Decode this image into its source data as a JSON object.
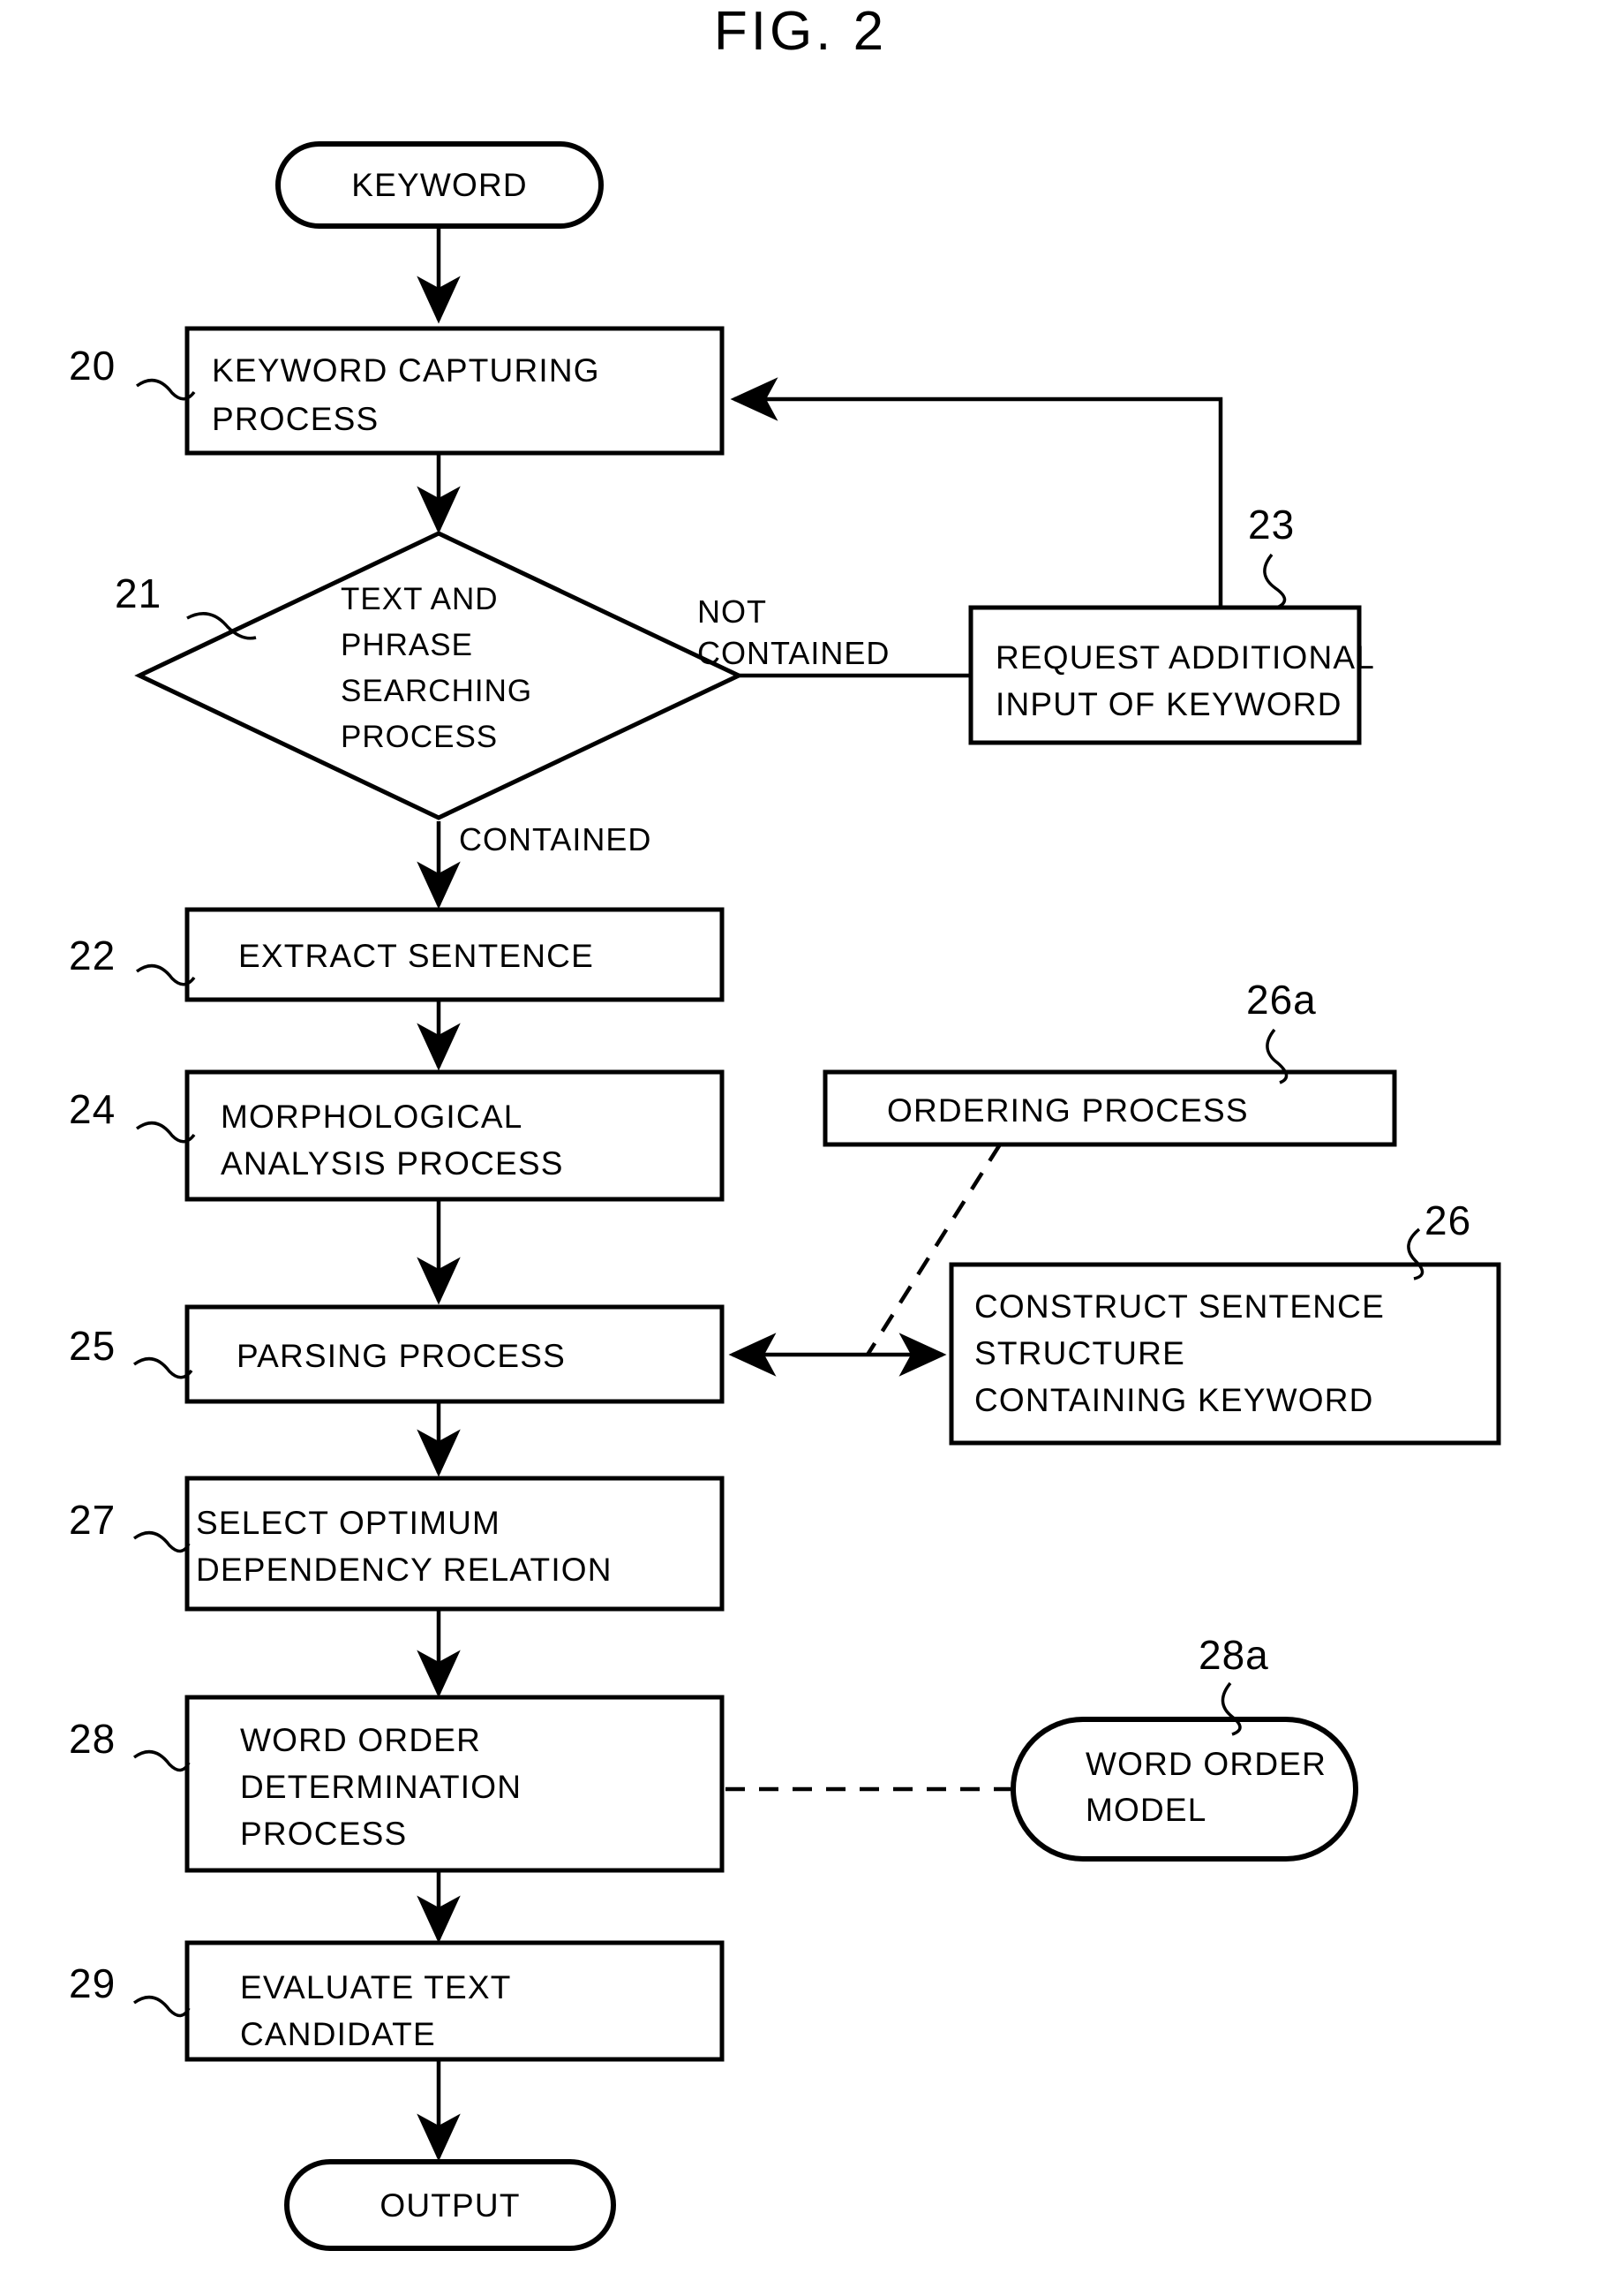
{
  "figure": {
    "title": "FIG. 2"
  },
  "nodes": {
    "start": {
      "label": "KEYWORD",
      "shape": "rounded-terminal"
    },
    "n20": {
      "ref": "20",
      "label_line1": "KEYWORD CAPTURING",
      "label_line2": "PROCESS",
      "shape": "process"
    },
    "n21": {
      "ref": "21",
      "label_line1": "TEXT AND",
      "label_line2": "PHRASE",
      "label_line3": "SEARCHING",
      "label_line4": "PROCESS",
      "shape": "decision"
    },
    "n23": {
      "ref": "23",
      "label_line1": "REQUEST ADDITIONAL",
      "label_line2": "INPUT OF KEYWORD",
      "shape": "process"
    },
    "n22": {
      "ref": "22",
      "label_line1": "EXTRACT SENTENCE",
      "shape": "process"
    },
    "n24": {
      "ref": "24",
      "label_line1": "MORPHOLOGICAL",
      "label_line2": "ANALYSIS PROCESS",
      "shape": "process"
    },
    "n26a": {
      "ref": "26a",
      "label_line1": "ORDERING PROCESS",
      "shape": "process"
    },
    "n25": {
      "ref": "25",
      "label_line1": "PARSING PROCESS",
      "shape": "process"
    },
    "n26": {
      "ref": "26",
      "label_line1": "CONSTRUCT SENTENCE",
      "label_line2": "STRUCTURE",
      "label_line3": "CONTAINING KEYWORD",
      "shape": "process"
    },
    "n27": {
      "ref": "27",
      "label_line1": "SELECT OPTIMUM",
      "label_line2": "DEPENDENCY RELATION",
      "shape": "process"
    },
    "n28": {
      "ref": "28",
      "label_line1": "WORD ORDER",
      "label_line2": "DETERMINATION",
      "label_line3": "PROCESS",
      "shape": "process"
    },
    "n28a": {
      "ref": "28a",
      "label_line1": "WORD ORDER",
      "label_line2": "MODEL",
      "shape": "rounded-terminal"
    },
    "n29": {
      "ref": "29",
      "label_line1": "EVALUATE TEXT",
      "label_line2": "CANDIDATE",
      "shape": "process"
    },
    "end": {
      "label": "OUTPUT",
      "shape": "rounded-terminal"
    }
  },
  "edge_labels": {
    "not_contained_line1": "NOT",
    "not_contained_line2": "CONTAINED",
    "contained": "CONTAINED"
  },
  "colors": {
    "ink": "#000000",
    "paper": "#ffffff"
  }
}
